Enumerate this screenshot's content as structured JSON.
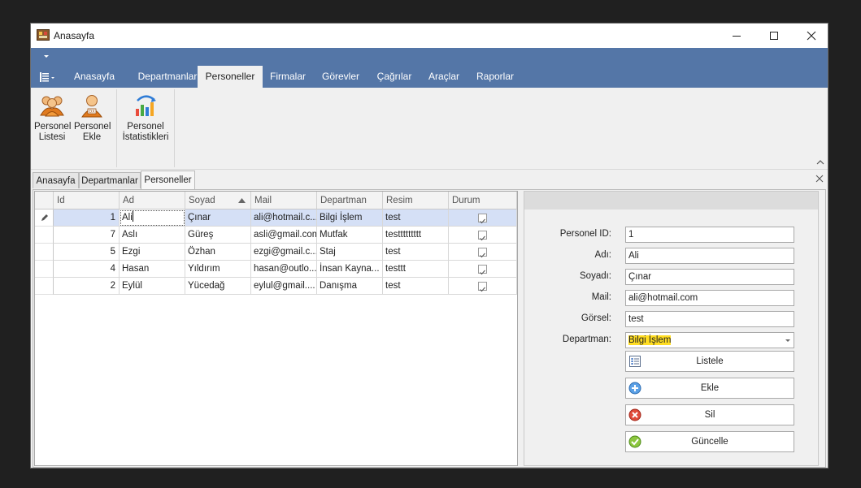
{
  "window": {
    "title": "Anasayfa"
  },
  "ribbon": {
    "tabs": [
      "Anasayfa",
      "Departmanlar",
      "Personeller",
      "Firmalar",
      "Görevler",
      "Çağrılar",
      "Araçlar",
      "Raporlar"
    ],
    "active_tab": "Personeller",
    "buttons": {
      "personel_listesi": {
        "line1": "Personel",
        "line2": "Listesi"
      },
      "personel_ekle": {
        "line1": "Personel",
        "line2": "Ekle"
      },
      "personel_istatistikleri": {
        "line1": "Personel",
        "line2": "İstatistikleri"
      }
    }
  },
  "doc_tabs": [
    "Anasayfa",
    "Departmanlar",
    "Personeller"
  ],
  "grid": {
    "columns": [
      "Id",
      "Ad",
      "Soyad",
      "Mail",
      "Departman",
      "Resim",
      "Durum"
    ],
    "sort_column": "Soyad",
    "rows": [
      {
        "id": "1",
        "ad": "Ali",
        "soyad": "Çınar",
        "mail": "ali@hotmail.c...",
        "departman": "Bilgi İşlem",
        "resim": "test",
        "durum": true
      },
      {
        "id": "7",
        "ad": "Aslı",
        "soyad": "Güreş",
        "mail": "asli@gmail.com",
        "departman": "Mutfak",
        "resim": "testtttttttt",
        "durum": true
      },
      {
        "id": "5",
        "ad": "Ezgi",
        "soyad": "Özhan",
        "mail": "ezgi@gmail.c...",
        "departman": "Staj",
        "resim": "test",
        "durum": true
      },
      {
        "id": "4",
        "ad": "Hasan",
        "soyad": "Yıldırım",
        "mail": "hasan@outlo...",
        "departman": "İnsan Kayna...",
        "resim": "testtt",
        "durum": true
      },
      {
        "id": "2",
        "ad": "Eylül",
        "soyad": "Yücedağ",
        "mail": "eylul@gmail....",
        "departman": "Danışma",
        "resim": "test",
        "durum": true
      }
    ]
  },
  "form": {
    "labels": {
      "id": "Personel ID:",
      "ad": "Adı:",
      "soyad": "Soyadı:",
      "mail": "Mail:",
      "gorsel": "Görsel:",
      "departman": "Departman:"
    },
    "values": {
      "id": "1",
      "ad": "Ali",
      "soyad": "Çınar",
      "mail": "ali@hotmail.com",
      "gorsel": "test",
      "departman": "Bilgi İşlem"
    },
    "buttons": {
      "listele": "Listele",
      "ekle": "Ekle",
      "sil": "Sil",
      "guncelle": "Güncelle"
    }
  },
  "colors": {
    "ribbon_blue": "#5476a7",
    "selected_row": "#d5e0f6",
    "highlight": "#ffdd22"
  }
}
